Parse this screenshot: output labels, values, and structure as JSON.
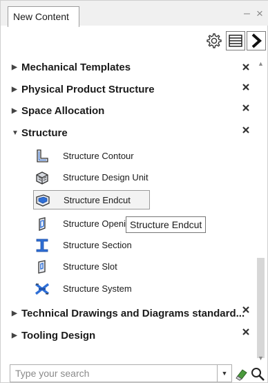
{
  "panel": {
    "title": "New Content",
    "minimize_glyph": "–",
    "close_glyph": "×"
  },
  "toolbar": {
    "buttons": [
      {
        "icon": "gear-icon"
      },
      {
        "icon": "list-view-icon"
      },
      {
        "icon": "chevron-right-icon"
      }
    ]
  },
  "tree": {
    "categories": [
      {
        "label": "Mechanical Templates",
        "expanded": false
      },
      {
        "label": "Physical Product Structure",
        "expanded": false
      },
      {
        "label": "Space Allocation",
        "expanded": false
      },
      {
        "label": "Structure",
        "expanded": true
      },
      {
        "label": "Technical Drawings and Diagrams standard...",
        "expanded": false
      },
      {
        "label": "Tooling Design",
        "expanded": false
      }
    ],
    "structure_items": [
      {
        "label": "Structure Contour",
        "icon": "structure-contour-icon"
      },
      {
        "label": "Structure Design Unit",
        "icon": "structure-design-unit-icon"
      },
      {
        "label": "Structure Endcut",
        "icon": "structure-endcut-icon",
        "selected": true
      },
      {
        "label": "Structure Openi",
        "icon": "structure-opening-icon"
      },
      {
        "label": "Structure Section",
        "icon": "structure-section-icon"
      },
      {
        "label": "Structure Slot",
        "icon": "structure-slot-icon"
      },
      {
        "label": "Structure System",
        "icon": "structure-system-icon"
      }
    ],
    "tooltip": "Structure Endcut"
  },
  "search": {
    "placeholder": "Type your search",
    "value": ""
  },
  "colors": {
    "header_bg": "#f0f0f0",
    "icon_blue": "#2f6fd6",
    "eraser_green": "#4a9a3c"
  }
}
